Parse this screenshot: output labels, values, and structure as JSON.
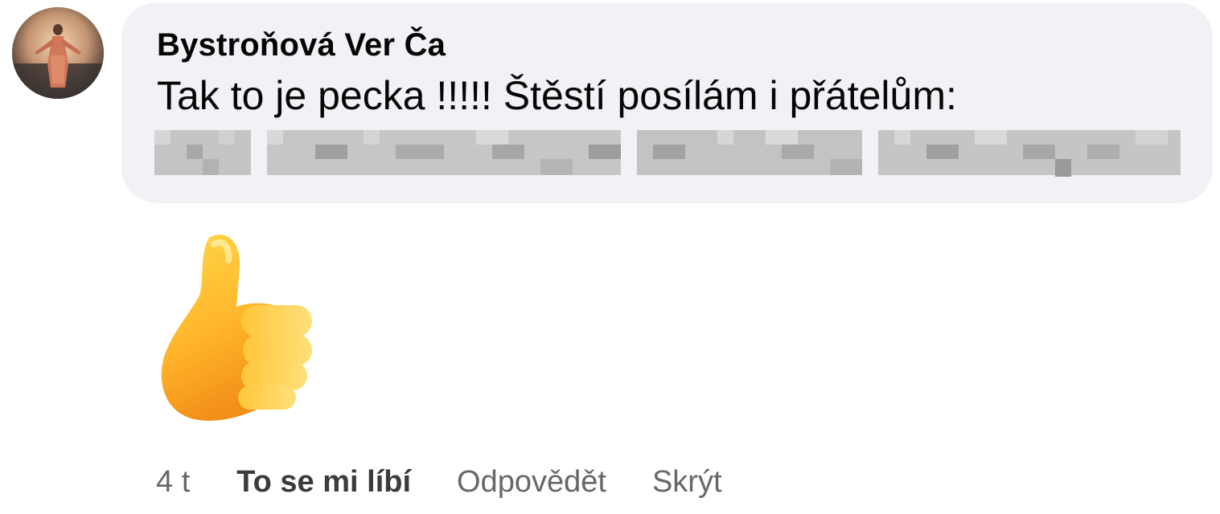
{
  "comment": {
    "author": "Bystroňová Ver Ča",
    "text": "Tak to je pecka !!!!! Štěstí posílám i přátelům:",
    "has_redacted_mentions": true,
    "sticker_icon": "thumbs-up-icon"
  },
  "actions": {
    "timestamp": "4 t",
    "like_label": "To se mi líbí",
    "reply_label": "Odpovědět",
    "hide_label": "Skrýt"
  },
  "colors": {
    "bubble": "#f0f2f5",
    "text": "#050505",
    "action_text": "#65676b"
  }
}
